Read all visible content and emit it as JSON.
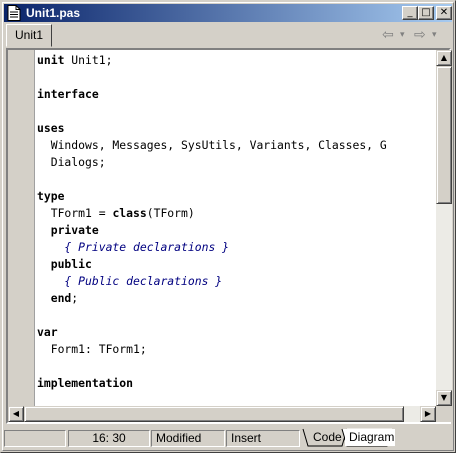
{
  "window": {
    "title": "Unit1.pas"
  },
  "titlebar_buttons": {
    "minimize": "_",
    "maximize": "□",
    "close": "✕"
  },
  "tabs": [
    {
      "label": "Unit1"
    }
  ],
  "nav": {
    "back": "⇦",
    "back_dropdown": "▾",
    "forward": "⇨",
    "forward_dropdown": "▾"
  },
  "code": {
    "lines": [
      [
        {
          "t": "unit",
          "k": "kw"
        },
        {
          "t": " Unit1;"
        }
      ],
      [],
      [
        {
          "t": "interface",
          "k": "kw"
        }
      ],
      [],
      [
        {
          "t": "uses",
          "k": "kw"
        }
      ],
      [
        {
          "t": "  Windows, Messages, SysUtils, Variants, Classes, G"
        }
      ],
      [
        {
          "t": "  Dialogs;"
        }
      ],
      [],
      [
        {
          "t": "type",
          "k": "kw"
        }
      ],
      [
        {
          "t": "  TForm1 = "
        },
        {
          "t": "class",
          "k": "kw"
        },
        {
          "t": "(TForm)"
        }
      ],
      [
        {
          "t": "  private",
          "k": "kw"
        }
      ],
      [
        {
          "t": "    { Private declarations }",
          "k": "cm"
        }
      ],
      [
        {
          "t": "  public",
          "k": "kw"
        }
      ],
      [
        {
          "t": "    { Public declarations }",
          "k": "cm"
        }
      ],
      [
        {
          "t": "  end",
          "k": "kw"
        },
        {
          "t": ";"
        }
      ],
      [],
      [
        {
          "t": "var",
          "k": "kw"
        }
      ],
      [
        {
          "t": "  Form1: TForm1;"
        }
      ],
      [],
      [
        {
          "t": "implementation",
          "k": "kw"
        }
      ],
      []
    ]
  },
  "scrollbar_arrows": {
    "up": "▲",
    "down": "▼",
    "left": "◀",
    "right": "▶"
  },
  "status": {
    "position": "16:  30",
    "modified": "Modified",
    "mode": "Insert",
    "view_tabs": [
      {
        "label": "Code"
      },
      {
        "label": "Diagram"
      }
    ]
  },
  "colors": {
    "title_start": "#0a246a",
    "title_end": "#a6caf0",
    "face": "#d4d0c8",
    "comment": "#000080"
  }
}
